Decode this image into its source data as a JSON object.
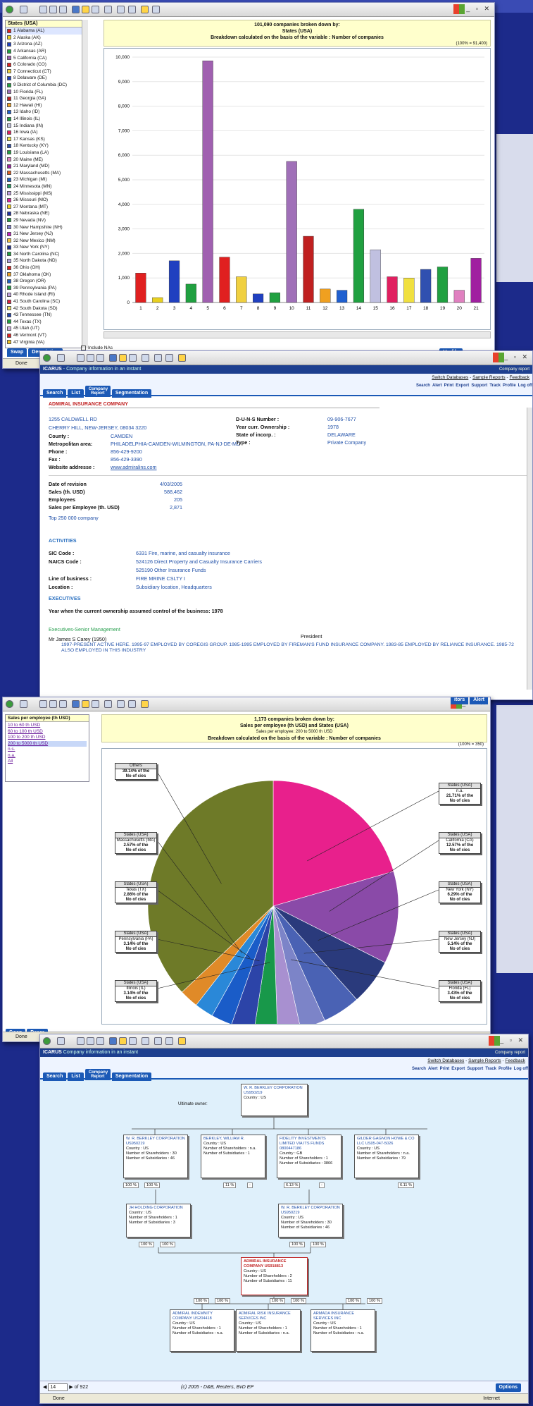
{
  "windows": {
    "w1": {
      "status": "Done",
      "legend_title": "States (USA)",
      "legend": [
        {
          "label": "1  Alabama (AL)",
          "color": "#e02020"
        },
        {
          "label": "2  Alaska (AK)",
          "color": "#e8d020"
        },
        {
          "label": "3  Arizona (AZ)",
          "color": "#2040c0"
        },
        {
          "label": "4  Arkansas (AR)",
          "color": "#20a040"
        },
        {
          "label": "5  California (CA)",
          "color": "#a060b0"
        },
        {
          "label": "6  Colorado (CO)",
          "color": "#e02020"
        },
        {
          "label": "7  Connecticut (CT)",
          "color": "#f0d040"
        },
        {
          "label": "8  Delaware (DE)",
          "color": "#2040c0"
        },
        {
          "label": "9  District of Columbia (DC)",
          "color": "#20a040"
        },
        {
          "label": "10  Florida (FL)",
          "color": "#a070b8"
        },
        {
          "label": "11  Georgia (GA)",
          "color": "#c02020"
        },
        {
          "label": "12  Hawaii (HI)",
          "color": "#f0a020"
        },
        {
          "label": "13  Idaho (ID)",
          "color": "#2060d0"
        },
        {
          "label": "14  Illinois (IL)",
          "color": "#20a040"
        },
        {
          "label": "15  Indiana (IN)",
          "color": "#c0c0e0"
        },
        {
          "label": "16  Iowa (IA)",
          "color": "#e02060"
        },
        {
          "label": "17  Kansas (KS)",
          "color": "#f0e040"
        },
        {
          "label": "18  Kentucky (KY)",
          "color": "#3050b0"
        },
        {
          "label": "19  Louisiana (LA)",
          "color": "#20a040"
        },
        {
          "label": "20  Maine (ME)",
          "color": "#e080c0"
        },
        {
          "label": "21  Maryland (MD)",
          "color": "#a020a0"
        },
        {
          "label": "22  Massachusetts (MA)",
          "color": "#e06020"
        },
        {
          "label": "23  Michigan (MI)",
          "color": "#2060c0"
        },
        {
          "label": "24  Minnesota (MN)",
          "color": "#20a060"
        },
        {
          "label": "25  Mississippi (MS)",
          "color": "#c0a0e0"
        },
        {
          "label": "26  Missouri (MO)",
          "color": "#e020a0"
        },
        {
          "label": "27  Montana (MT)",
          "color": "#f0d020"
        },
        {
          "label": "28  Nebraska (NE)",
          "color": "#2030a0"
        },
        {
          "label": "29  Nevada (NV)",
          "color": "#20a040"
        },
        {
          "label": "30  New Hampshire (NH)",
          "color": "#8080d0"
        },
        {
          "label": "31  New Jersey (NJ)",
          "color": "#c020c0"
        },
        {
          "label": "32  New Mexico (NM)",
          "color": "#f0c040"
        },
        {
          "label": "33  New York (NY)",
          "color": "#203090"
        },
        {
          "label": "34  North Carolina (NC)",
          "color": "#20a040"
        },
        {
          "label": "35  North Dakota (ND)",
          "color": "#b0a0e0"
        },
        {
          "label": "36  Ohio (OH)",
          "color": "#e02020"
        },
        {
          "label": "37  Oklahoma (OK)",
          "color": "#f0a020"
        },
        {
          "label": "38  Oregon (OR)",
          "color": "#2060c0"
        },
        {
          "label": "39  Pennsylvania (PA)",
          "color": "#20a040"
        },
        {
          "label": "40  Rhode Island (RI)",
          "color": "#c0a0e0"
        },
        {
          "label": "41  South Carolina (SC)",
          "color": "#e02040"
        },
        {
          "label": "42  South Dakota (SD)",
          "color": "#f0e060"
        },
        {
          "label": "43  Tennessee (TN)",
          "color": "#2040b0"
        },
        {
          "label": "44  Texas (TX)",
          "color": "#20a040"
        },
        {
          "label": "45  Utah (UT)",
          "color": "#d0b0e0"
        },
        {
          "label": "46  Vermont (VT)",
          "color": "#e02020"
        },
        {
          "label": "47  Virginia (VA)",
          "color": "#f0c020"
        }
      ],
      "include_nas": "Include NAs",
      "swap": "Swap",
      "description": "Description",
      "modify": "Modify",
      "heading1": "101,090 companies broken down by:",
      "heading2": "States (USA)",
      "heading3": "Breakdown calculated on the basis of the variable : Number of companies",
      "scale_note": "(100% = 91,400)"
    },
    "w2": {
      "app_name": "ICARUS",
      "app_tagline": "- Company information in an instant",
      "company_report": "Company report",
      "links": [
        "Switch Databases",
        "Sample Reports",
        "Feedback"
      ],
      "tabs": [
        "Search",
        "List",
        "Company Report",
        "Segmentation"
      ],
      "tools": [
        "Search",
        "Alert",
        "Print",
        "Export",
        "Support",
        "Track",
        "Profile",
        "Log off"
      ],
      "company": "ADMIRAL INSURANCE COMPANY",
      "address1": "1255 CALDWELL RD",
      "address2": "CHERRY HILL, NEW-JERSEY, 08034 3220",
      "fields": [
        {
          "k": "County :",
          "v": "CAMDEN"
        },
        {
          "k": "Metropolitan area:",
          "v": "PHILADELPHIA-CAMDEN-WILMINGTON, PA-NJ-DE-MD"
        },
        {
          "k": "Phone :",
          "v": "856-429-9200"
        },
        {
          "k": "Fax :",
          "v": "856-429-3390"
        },
        {
          "k": "Website addresse :",
          "v": "www.admiralins.com"
        }
      ],
      "right_fields": [
        {
          "k": "D-U-N-S Number :",
          "v": "09-906-7677"
        },
        {
          "k": "Year curr. Ownership :",
          "v": "1978"
        },
        {
          "k": "State of incorp. :",
          "v": "DELAWARE"
        },
        {
          "k": "Type :",
          "v": "Private Company"
        }
      ],
      "fin": [
        {
          "k": "Date of revision",
          "v": "4/03/2005"
        },
        {
          "k": "Sales (th. USD)",
          "v": "588,462"
        },
        {
          "k": "Employees",
          "v": "205"
        },
        {
          "k": "Sales per Employee (th. USD)",
          "v": "2,871"
        }
      ],
      "top_note": "Top 250 000 company",
      "activities_title": "ACTIVITIES",
      "activities": [
        {
          "k": "SIC Code :",
          "v": "6331 Fire, marine, and casualty insurance"
        },
        {
          "k": "NAICS Code :",
          "v": "524126 Direct Property and Casualty Insurance Carriers"
        },
        {
          "k": "",
          "v": "525190 Other Insurance Funds"
        },
        {
          "k": "Line of business :",
          "v": "FIRE MRINE CSLTY I"
        },
        {
          "k": "Location :",
          "v": "Subsidiary location, Headquarters"
        }
      ],
      "executives_title": "EXECUTIVES",
      "ownership_note": "Year when the current ownership assumed control of the business: 1978",
      "exec_section": "Executives-Senior Management",
      "exec_name": "Mr James S Carey (1950)",
      "exec_title": "President",
      "exec_bio": "1997-PRESENT ACTIVE HERE. 1995-97 EMPLOYED BY COREGIS GROUP. 1985-1995 EMPLOYED BY FIREMAN'S FUND INSURANCE COMPANY. 1983-85 EMPLOYED BY RELIANCE INSURANCE. 1985-72 ALSO EMPLOYED IN THIS INDUSTRY"
    },
    "w3": {
      "status": "Done",
      "filter_title": "Sales per employee (th USD)",
      "filters": [
        "10 to 60 th USD",
        "60 to 100 th USD",
        "100 to 200 th USD",
        "200 to 5000 th USD",
        "n.s.",
        "n.a.",
        "All"
      ],
      "heading1": "1,173 companies broken down by:",
      "heading2": "Sales per employee (th USD) and States (USA)",
      "heading2b": "Sales per employee: 200 to 5000 th USD",
      "heading3": "Breakdown calculated on the basis of the variable : Number of companies",
      "scale_note": "(100% = 350)",
      "swap": "Swap",
      "desc": "Descr",
      "editors": "itors",
      "alert": "Alert"
    },
    "w4": {
      "app_name": "ICARUS",
      "app_tagline": "Company information in an instant",
      "company_report": "Company report",
      "links": [
        "Switch Databases",
        "Sample Reports",
        "Feedback"
      ],
      "tabs": [
        "Search",
        "List",
        "Company Report",
        "Segmentation"
      ],
      "tools": [
        "Search",
        "Alert",
        "Print",
        "Export",
        "Support",
        "Track",
        "Profile",
        "Log off"
      ],
      "ultimate_owner": "Ultimate owner:",
      "top": {
        "name": "W. R. BERKLEY CORPORATION US950219",
        "lines": [
          "Country : US"
        ]
      },
      "row2": [
        {
          "name": "W. R. BERKLEY CORPORATION US950219",
          "lines": [
            "Country : US",
            "Number of Shareholders : 30",
            "Number of Subsidiaries : 46"
          ]
        },
        {
          "name": "BERKLEY, WILLIAM R.",
          "lines": [
            "Country : US",
            "Number of Shareholders : n.a.",
            "Number of Subsidiaries : 1"
          ]
        },
        {
          "name": "FIDELITY INVESTMENTS LIMITED via its funds 0800447186",
          "lines": [
            "Country : GB",
            "Number of Shareholders : 1",
            "Number of Subsidiaries : 3866"
          ]
        },
        {
          "name": "GILDER GAGNON HOWE & CO LLC US05-047-5026",
          "lines": [
            "Country : US",
            "Number of Shareholders : n.a.",
            "Number of Subsidiaries : 79"
          ]
        }
      ],
      "row2_pct": [
        "100 %",
        "100 %",
        "11 %",
        "-",
        "6.13 %",
        "-",
        "6.11 %"
      ],
      "row3": [
        {
          "name": "JH HOLDING CORPORATION",
          "lines": [
            "Country : US",
            "Number of Shareholders : 1",
            "Number of Subsidiaries : 3"
          ]
        },
        {
          "name": "W. R. BERKLEY CORPORATION US950219",
          "lines": [
            "Country : US",
            "Number of Shareholders : 30",
            "Number of Subsidiaries : 46"
          ]
        }
      ],
      "row3_pct": [
        "100 %",
        "100 %",
        "100 %",
        "100 %"
      ],
      "subject": {
        "name": "ADMIRAL INSURANCE COMPANY US918813",
        "lines": [
          "Country : US",
          "Number of Shareholders : 2",
          "Number of Subsidiaries : 11"
        ]
      },
      "row4_pct": [
        "100 %",
        "100 %",
        "100 %",
        "100 %",
        "100 %",
        "100 %"
      ],
      "row4": [
        {
          "name": "ADMIRAL INDEMNITY COMPANY US204418",
          "lines": [
            "Country : US",
            "Number of Shareholders : 1",
            "Number of Subsidiaries : n.a."
          ]
        },
        {
          "name": "ADMIRAL RISK INSURANCE SERVICES INC",
          "lines": [
            "Country : US",
            "Number of Shareholders : 1",
            "Number of Subsidiaries : n.a."
          ]
        },
        {
          "name": "ARMADA INSURANCE SERVICES INC",
          "lines": [
            "Country : US",
            "Number of Shareholders : 1",
            "Number of Subsidiaries : n.a."
          ]
        }
      ],
      "page_current": "14",
      "page_total": "of 922",
      "copyright": "(c) 2005 - D&B, Reuters, BvD EP",
      "options": "Options",
      "status": "Done",
      "internet": "Internet"
    }
  },
  "chart_data": [
    {
      "type": "bar",
      "title": "101,090 companies broken down by: States (USA)",
      "categories": [
        "1",
        "2",
        "3",
        "4",
        "5",
        "6",
        "7",
        "8",
        "9",
        "10",
        "11",
        "12",
        "13",
        "14",
        "15",
        "16",
        "17",
        "18",
        "19",
        "20",
        "21"
      ],
      "values": [
        1200,
        200,
        1700,
        750,
        9850,
        1850,
        1050,
        350,
        400,
        5750,
        2700,
        550,
        500,
        3800,
        2150,
        1050,
        1000,
        1350,
        1450,
        500,
        1800
      ],
      "colors": [
        "#e02020",
        "#e8d020",
        "#2040c0",
        "#20a040",
        "#a060b0",
        "#e02020",
        "#f0d040",
        "#2040c0",
        "#20a040",
        "#a070b8",
        "#c02020",
        "#f0a020",
        "#2060d0",
        "#20a040",
        "#c0c0e0",
        "#e02060",
        "#f0e040",
        "#3050b0",
        "#20a040",
        "#e080c0",
        "#a020a0"
      ],
      "ylim": [
        0,
        10000
      ],
      "yticks": [
        "0",
        "1,000",
        "2,000",
        "3,000",
        "4,000",
        "5,000",
        "6,000",
        "7,000",
        "8,000",
        "9,000",
        "10,000"
      ]
    },
    {
      "type": "pie",
      "title": "1,173 companies broken down by: Sales per employee (th USD) and States (USA)",
      "slices": [
        {
          "value": 21.71,
          "color": "#e8208c",
          "hd": "States (USA)",
          "sub": "n.a.",
          "pct": "21.71% of the",
          "unit": "No of cies"
        },
        {
          "value": 12.57,
          "color": "#8a4aa8",
          "hd": "States (USA)",
          "sub": "California (CA)",
          "pct": "12.57% of the",
          "unit": "No of cies"
        },
        {
          "value": 6.29,
          "color": "#2a3a7c",
          "hd": "States (USA)",
          "sub": "New York (NY)",
          "pct": "6.29% of the",
          "unit": "No of cies"
        },
        {
          "value": 5.14,
          "color": "#4a62b4",
          "hd": "States (USA)",
          "sub": "New Jersey (NJ)",
          "pct": "5.14% of the",
          "unit": "No of cies"
        },
        {
          "value": 3.43,
          "color": "#7c84c8",
          "hd": "States (USA)",
          "sub": "Florida (FL)",
          "pct": "3.43% of the",
          "unit": "No of cies"
        },
        {
          "value": 3.14,
          "color": "#a890d0",
          "hd": "",
          "sub": "",
          "pct": "",
          "unit": ""
        },
        {
          "value": 3.14,
          "color": "#18984a",
          "hd": "States (USA)",
          "sub": "Illinois (IL)",
          "pct": "3.14% of the",
          "unit": "No of cies"
        },
        {
          "value": 3.14,
          "color": "#2c44a8",
          "hd": "States (USA)",
          "sub": "Pennsylvania (PA)",
          "pct": "3.14% of the",
          "unit": "No of cies"
        },
        {
          "value": 2.86,
          "color": "#1a5cc8",
          "hd": "States (USA)",
          "sub": "Texas (TX)",
          "pct": "2.86% of the",
          "unit": "No of cies"
        },
        {
          "value": 2.57,
          "color": "#2a88d8",
          "hd": "States (USA)",
          "sub": "Massachusetts (MA)",
          "pct": "2.57% of the",
          "unit": "No of cies"
        },
        {
          "value": 2.57,
          "color": "#e08a28",
          "hd": "",
          "sub": "",
          "pct": "",
          "unit": ""
        },
        {
          "value": 39.14,
          "color": "#6e7a28",
          "hd": "Others",
          "sub": "",
          "pct": "39.14% of the",
          "unit": "No of cies"
        }
      ]
    }
  ]
}
